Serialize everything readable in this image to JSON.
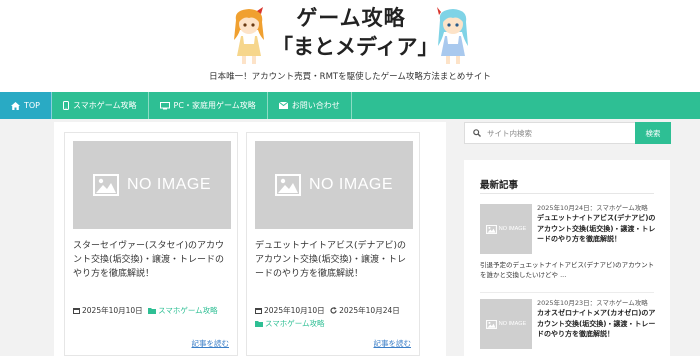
{
  "header": {
    "logo_line1": "ゲーム攻略",
    "logo_line2": "「まとメディア」",
    "tagline": "日本唯一！アカウント売買・RMTを駆使したゲーム攻略方法まとめサイト"
  },
  "nav": {
    "items": [
      {
        "label": "TOP",
        "icon": "home-icon",
        "active": true
      },
      {
        "label": "スマホゲーム攻略",
        "icon": "smartphone-icon"
      },
      {
        "label": "PC・家庭用ゲーム攻略",
        "icon": "monitor-icon"
      },
      {
        "label": "お問い合わせ",
        "icon": "mail-icon"
      }
    ]
  },
  "cards": [
    {
      "noimage": "NO IMAGE",
      "title": "スターセイヴァー(スタセイ)のアカウント交換(垢交換)・譲渡・トレードのやり方を徹底解説！",
      "date": "2025年10月10日",
      "category": "スマホゲーム攻略",
      "read_more": "記事を読む"
    },
    {
      "noimage": "NO IMAGE",
      "title": "デュエットナイトアビス(デナアビ)のアカウント交換(垢交換)・譲渡・トレードのやり方を徹底解説！",
      "date": "2025年10月10日",
      "updated": "2025年10月24日",
      "category": "スマホゲーム攻略",
      "read_more": "記事を読む"
    }
  ],
  "search": {
    "placeholder": "サイト内検索",
    "button": "検索"
  },
  "recent": {
    "heading": "最新記事",
    "items": [
      {
        "noimage": "NO IMAGE",
        "meta": "2025年10月24日：スマホゲーム攻略",
        "title": "デュエットナイトアビス(デナアビ)のアカウント交換(垢交換)・譲渡・トレードのやり方を徹底解説！",
        "excerpt": "引退予定のデュエットナイトアビス(デナアビ)のアカウントを誰かと交換したいけどや ..."
      },
      {
        "noimage": "NO IMAGE",
        "meta": "2025年10月23日：スマホゲーム攻略",
        "title": "カオスゼロナイトメア(カオゼロ)のアカウント交換(垢交換)・譲渡・トレードのやり方を徹底解説！",
        "excerpt": ""
      }
    ]
  },
  "colors": {
    "accent": "#2ebf94",
    "nav_active": "#29aac4",
    "link": "#3a7ec7",
    "placeholder_gray": "#cfcfcf"
  }
}
